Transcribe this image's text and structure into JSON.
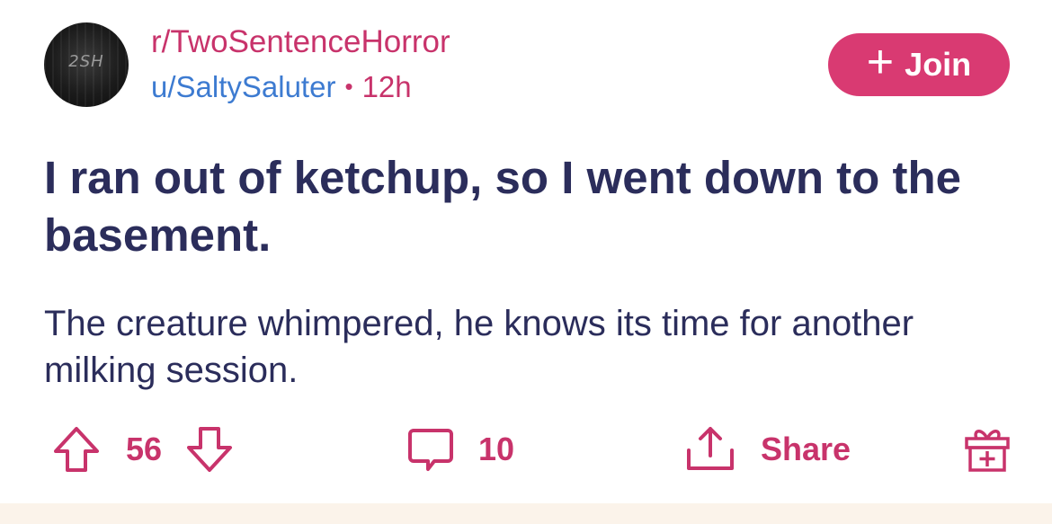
{
  "post": {
    "subreddit": "r/TwoSentenceHorror",
    "avatar_text": "2SH",
    "author": "u/SaltySaluter",
    "separator": "•",
    "time": "12h",
    "join_icon": "+",
    "join_label": "Join",
    "title": "I ran out of ketchup, so I went down to the basement.",
    "body": "The creature whimpered, he knows its time for another milking session."
  },
  "actions": {
    "upvote_icon": "arrow-up-icon",
    "score": "56",
    "downvote_icon": "arrow-down-icon",
    "comment_icon": "comment-bubble-icon",
    "comment_count": "10",
    "share_icon": "share-icon",
    "share_label": "Share",
    "award_icon": "gift-icon"
  },
  "colors": {
    "accent": "#d93a72",
    "text": "#2b2d5b",
    "link": "#3d7bd1",
    "footer_bg": "#fbf3ea"
  }
}
